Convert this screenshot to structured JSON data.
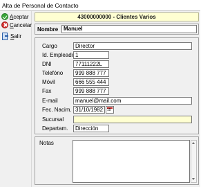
{
  "window": {
    "title": "Alta de Personal de Contacto"
  },
  "toolbar": {
    "accept_prefix": "A",
    "accept_rest": "ceptar",
    "cancel_prefix": "C",
    "cancel_rest": "ancelar",
    "exit_prefix": "S",
    "exit_rest": "alir"
  },
  "header": {
    "client": "43000000000 - Clientes Varios"
  },
  "nombre": {
    "label": "Nombre",
    "value": "Manuel"
  },
  "fields": [
    {
      "label": "Cargo",
      "value": "Director"
    },
    {
      "label": "Id. Empleado",
      "value": "1"
    },
    {
      "label": "DNI",
      "value": "77111222L"
    },
    {
      "label": "Telefóno",
      "value": "999 888 777"
    },
    {
      "label": "Móvil",
      "value": "666 555 444"
    },
    {
      "label": "Fax",
      "value": "999 888 777"
    },
    {
      "label": "E-mail",
      "value": "manuel@mail.com"
    },
    {
      "label": "Fec. Nacim.",
      "value": "31/10/1982"
    },
    {
      "label": "Sucursal",
      "value": ""
    },
    {
      "label": "Departam.",
      "value": "Dirección"
    }
  ],
  "calendar_button": {
    "day": "15"
  },
  "notes": {
    "label": "Notas",
    "value": ""
  }
}
